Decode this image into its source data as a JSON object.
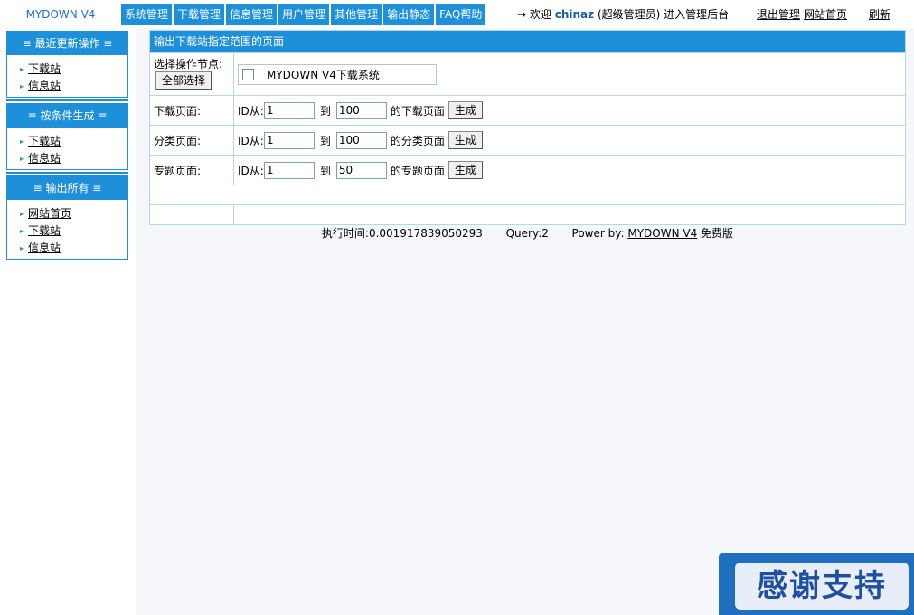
{
  "header": {
    "logo": "MYDOWN V4",
    "nav": [
      "系统管理",
      "下载管理",
      "信息管理",
      "用户管理",
      "其他管理",
      "输出静态",
      "FAQ帮助"
    ],
    "welcome_prefix": "→ 欢迎",
    "user": "chinaz",
    "welcome_suffix": "(超级管理员) 进入管理后台",
    "links": {
      "logout": "退出管理",
      "site_home": "网站首页",
      "refresh": "刷新"
    }
  },
  "sidebar": {
    "sections": [
      {
        "title": "≡ 最近更新操作 ≡",
        "items": [
          "下载站",
          "信息站"
        ]
      },
      {
        "title": "≡ 按条件生成 ≡",
        "items": [
          "下载站",
          "信息站"
        ]
      },
      {
        "title": "≡ 输出所有 ≡",
        "items": [
          "网站首页",
          "下载站",
          "信息站"
        ]
      }
    ]
  },
  "main": {
    "title": "输出下载站指定范围的页面",
    "node_label": "选择操作节点:",
    "select_all": "全部选择",
    "node_name": "MYDOWN V4下载系统",
    "rows": [
      {
        "label": "下载页面:",
        "id_from": "ID从:",
        "from": "1",
        "to_label": "到",
        "to": "100",
        "suffix": "的下载页面",
        "button": "生成"
      },
      {
        "label": "分类页面:",
        "id_from": "ID从:",
        "from": "1",
        "to_label": "到",
        "to": "100",
        "suffix": "的分类页面",
        "button": "生成"
      },
      {
        "label": "专题页面:",
        "id_from": "ID从:",
        "from": "1",
        "to_label": "到",
        "to": "50",
        "suffix": "的专题页面",
        "button": "生成"
      }
    ]
  },
  "footer": {
    "exec_time": "执行时间:0.001917839050293",
    "query": "Query:2",
    "power_prefix": "Power by:",
    "power_link": "MYDOWN V4",
    "power_suffix": "免费版"
  },
  "banner": {
    "text": "感谢支持"
  }
}
